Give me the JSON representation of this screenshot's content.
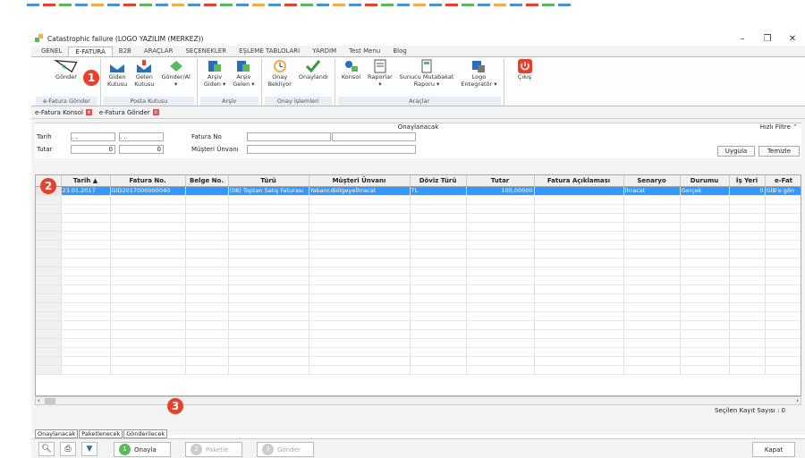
{
  "window": {
    "title": "Catastrophic failure (LOGO YAZILIM (MERKEZ))"
  },
  "menu": [
    "GENEL",
    "E-FATURA",
    "B2B",
    "ARAÇLAR",
    "SEÇENEKLER",
    "EŞLEME TABLOLARI",
    "YARDIM",
    "Test Menu",
    "Blog"
  ],
  "ribbon": {
    "groups": [
      {
        "label": "e-Fatura Gönder",
        "buttons": [
          {
            "label": "Gönder",
            "icon": "efatura-icon"
          }
        ]
      },
      {
        "label": "Posta Kutusu",
        "buttons": [
          {
            "label": "Giden\nKutusu",
            "icon": "outbox-icon"
          },
          {
            "label": "Gelen\nKutusu",
            "icon": "inbox-icon"
          },
          {
            "label": "Gönder/Al\n▾",
            "icon": "send-receive-icon"
          }
        ]
      },
      {
        "label": "Arşiv",
        "buttons": [
          {
            "label": "Arşiv\nGiden ▾",
            "icon": "archive-out-icon"
          },
          {
            "label": "Arşiv\nGelen ▾",
            "icon": "archive-in-icon"
          }
        ]
      },
      {
        "label": "Onay İşlemleri",
        "buttons": [
          {
            "label": "Onay\nBekliyor",
            "icon": "clock-icon"
          },
          {
            "label": "Onaylandı",
            "icon": "check-icon"
          }
        ]
      },
      {
        "label": "Araçlar",
        "buttons": [
          {
            "label": "Konsol",
            "icon": "console-icon"
          },
          {
            "label": "Raporlar\n▾",
            "icon": "reports-icon"
          },
          {
            "label": "Sunucu Mutabakat\nRaporu ▾",
            "icon": "server-report-icon"
          },
          {
            "label": "Logo\nEntegratör ▾",
            "icon": "integrator-icon"
          }
        ]
      },
      {
        "label": "",
        "buttons": [
          {
            "label": "Çıkış",
            "icon": "power-icon"
          }
        ]
      }
    ]
  },
  "doc_tabs": [
    "e-Fatura Konsol",
    "e-Fatura Gönder"
  ],
  "filter": {
    "header": "Onaylanacak",
    "quick_filter": "Hızlı Filtre",
    "tarih_label": "Tarih",
    "tutar_label": "Tutar",
    "date_placeholder": ". .",
    "tutar_from": "0",
    "tutar_to": "0",
    "fatura_no_label": "Fatura No",
    "musteri_label": "Müşteri Ünvanı",
    "apply": "Uygula",
    "clear": "Temizle"
  },
  "grid": {
    "columns": [
      "",
      "Tarih ▲",
      "Fatura No.",
      "Belge No.",
      "Türü",
      "Müşteri Ünvanı",
      "Döviz Türü",
      "Tutar",
      "Fatura Açıklaması",
      "Senaryo",
      "Durumu",
      "İş Yeri",
      "e-Fat"
    ],
    "rows": [
      [
        "",
        "23.01.2017",
        "GID2017000000040",
        "",
        "(08) Toptan Satış Faturası",
        "YabancıBölgeyeİhracat",
        "TL",
        "100,00000",
        "",
        "İhracat",
        "Gerçek",
        "0",
        "GİB'e gön"
      ]
    ]
  },
  "status": {
    "selected_count": "Seçilen Kayıt Sayısı : 0"
  },
  "bottom_tabs": [
    "Onaylanacak",
    "Paketlenecek",
    "Gönderilecek"
  ],
  "steps": [
    {
      "num": "1",
      "label": "Onayla"
    },
    {
      "num": "2",
      "label": "Paketle"
    },
    {
      "num": "3",
      "label": "Gönder"
    }
  ],
  "close_label": "Kapat",
  "callouts": [
    "1",
    "2",
    "3"
  ],
  "colors": {
    "selection": "#3399ff",
    "callout": "#e8402c",
    "step_active": "#5cb85c"
  }
}
